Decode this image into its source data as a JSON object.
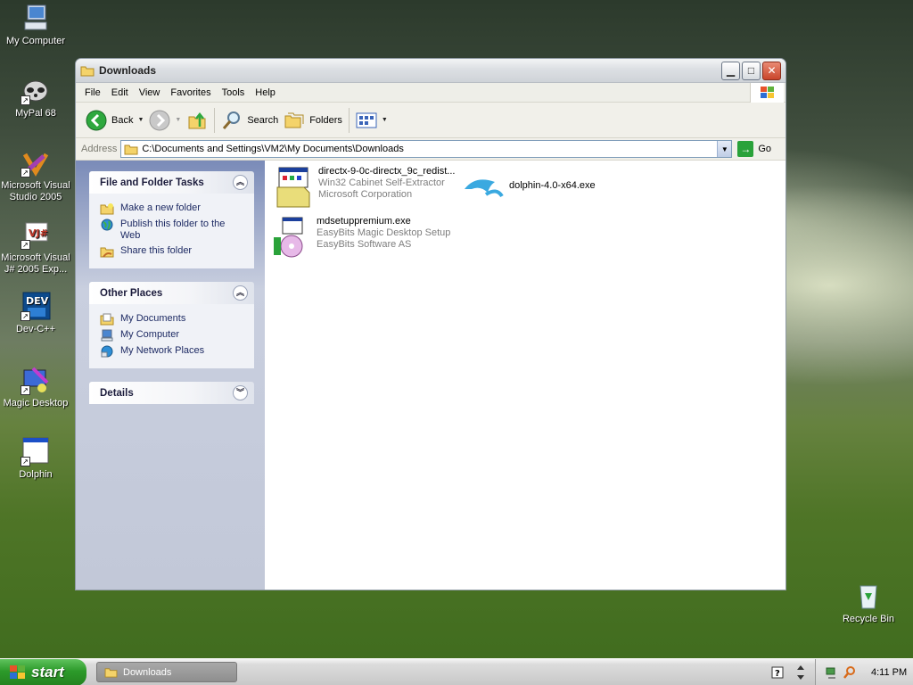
{
  "desktop": {
    "icons": [
      {
        "label": "My Computer"
      },
      {
        "label": "MyPal 68"
      },
      {
        "label": "Microsoft Visual Studio 2005"
      },
      {
        "label": "Microsoft Visual J# 2005 Exp..."
      },
      {
        "label": "Dev-C++"
      },
      {
        "label": "Magic Desktop"
      },
      {
        "label": "Dolphin"
      },
      {
        "label": "Recycle Bin"
      }
    ]
  },
  "window": {
    "title": "Downloads",
    "menu": [
      "File",
      "Edit",
      "View",
      "Favorites",
      "Tools",
      "Help"
    ],
    "toolbar": {
      "back_label": "Back",
      "search_label": "Search",
      "folders_label": "Folders"
    },
    "address": {
      "label": "Address",
      "value": "C:\\Documents and Settings\\VM2\\My Documents\\Downloads",
      "go_label": "Go"
    },
    "taskpane": {
      "file_tasks": {
        "title": "File and Folder Tasks",
        "items": [
          "Make a new folder",
          "Publish this folder to the Web",
          "Share this folder"
        ]
      },
      "other_places": {
        "title": "Other Places",
        "items": [
          "My Documents",
          "My Computer",
          "My Network Places"
        ]
      },
      "details": {
        "title": "Details"
      }
    },
    "files": [
      {
        "name": "directx-9-0c-directx_9c_redist...",
        "type": "Win32 Cabinet Self-Extractor",
        "company": "Microsoft Corporation"
      },
      {
        "name": "dolphin-4.0-x64.exe"
      },
      {
        "name": "mdsetuppremium.exe",
        "type": "EasyBits Magic Desktop Setup",
        "company": "EasyBits Software AS"
      }
    ]
  },
  "taskbar": {
    "start_label": "start",
    "task_label": "Downloads",
    "clock": "4:11 PM"
  }
}
